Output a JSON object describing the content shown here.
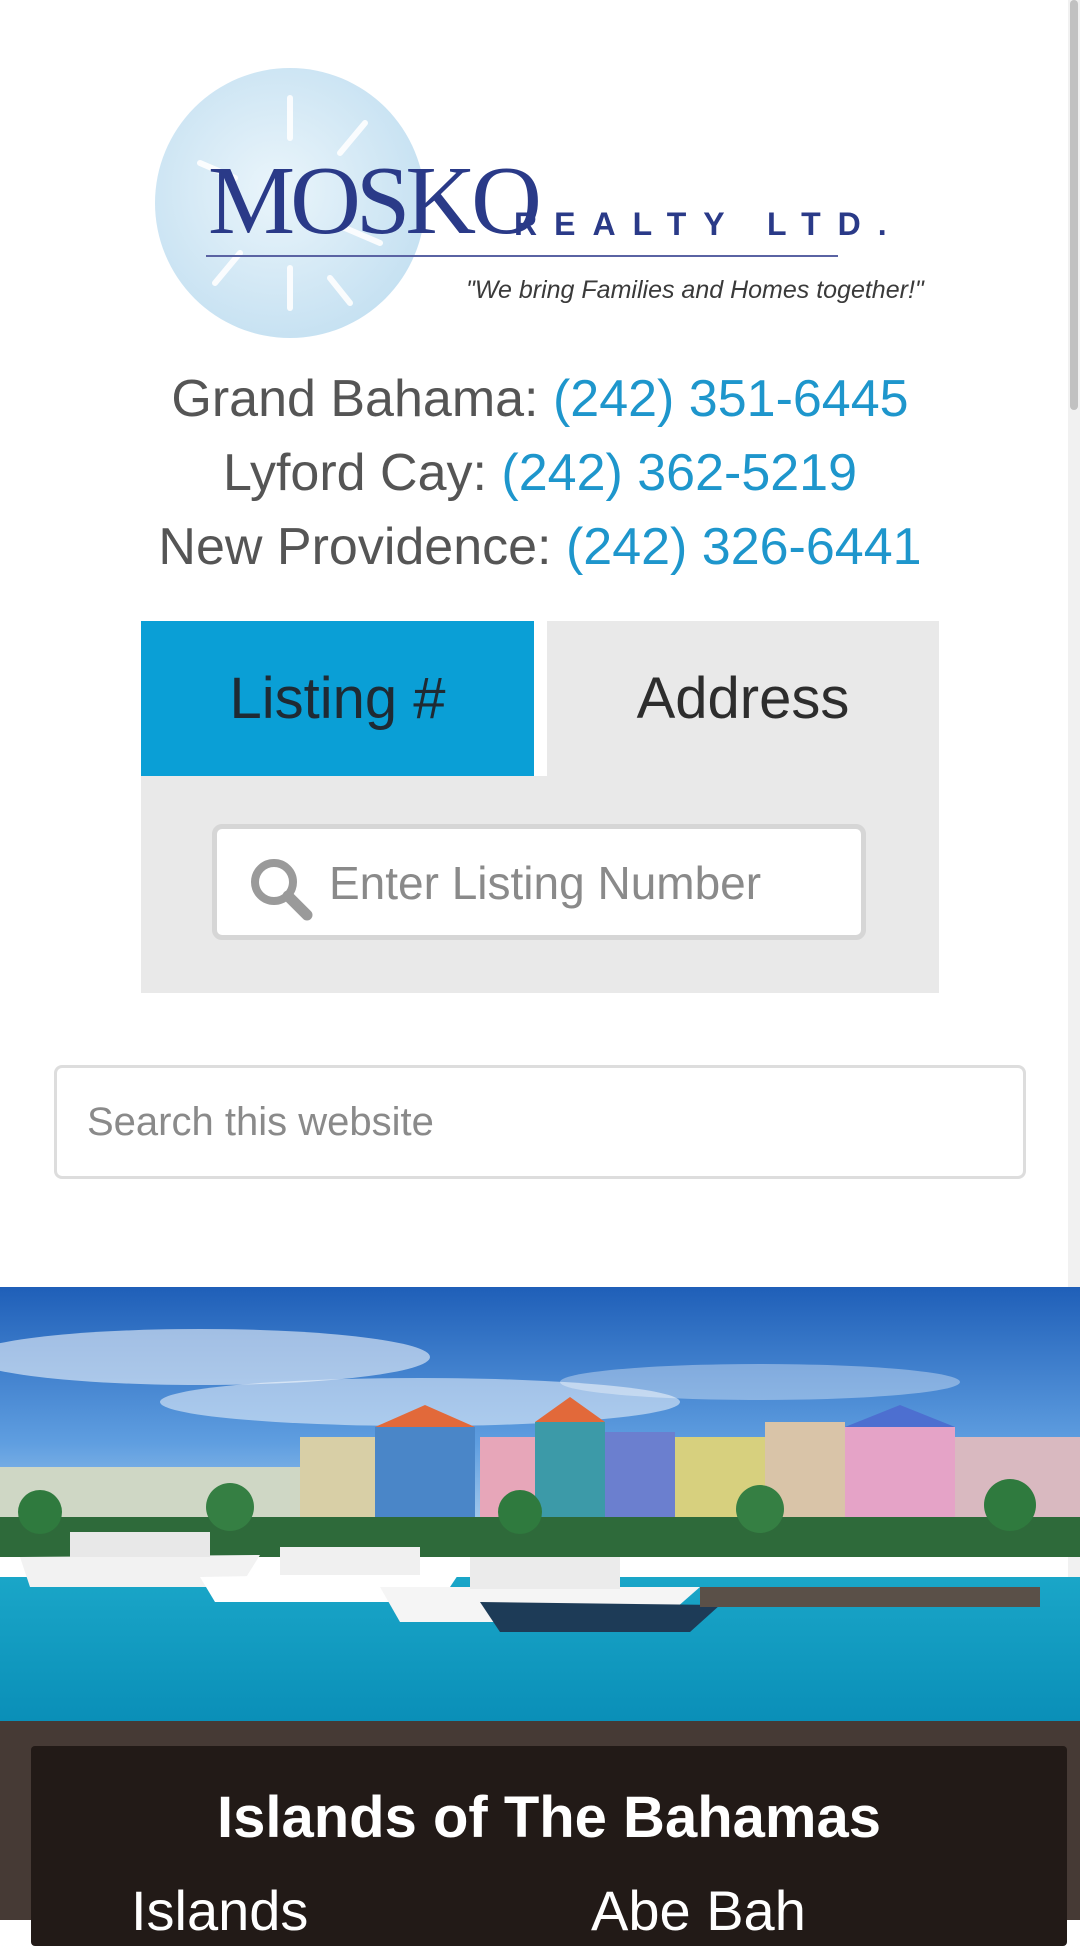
{
  "logo": {
    "brand": "MOSKO",
    "subtitle": "REALTY LTD.",
    "tagline": "\"We bring Families and Homes together!\""
  },
  "contacts": [
    {
      "label": "Grand Bahama:",
      "phone": "(242) 351-6445"
    },
    {
      "label": "Lyford Cay:",
      "phone": "(242) 362-5219"
    },
    {
      "label": "New Providence:",
      "phone": "(242) 326-6441"
    }
  ],
  "listing_search": {
    "tab_listing": "Listing #",
    "tab_address": "Address",
    "active_tab": "Listing #",
    "input_placeholder": "Enter Listing Number",
    "input_value": ""
  },
  "site_search": {
    "placeholder": "Search this website",
    "value": ""
  },
  "islands_section": {
    "title": "Islands of The Bahamas",
    "col_a_partial": "Islands",
    "col_b_partial": "Abe Bah"
  },
  "colors": {
    "accent": "#0a9fd6",
    "link": "#1e96cc",
    "panel": "#e9e9e9",
    "dark_bg": "#463a35",
    "card_bg": "#221a17"
  },
  "icons": {
    "search": "magnifying-glass"
  }
}
